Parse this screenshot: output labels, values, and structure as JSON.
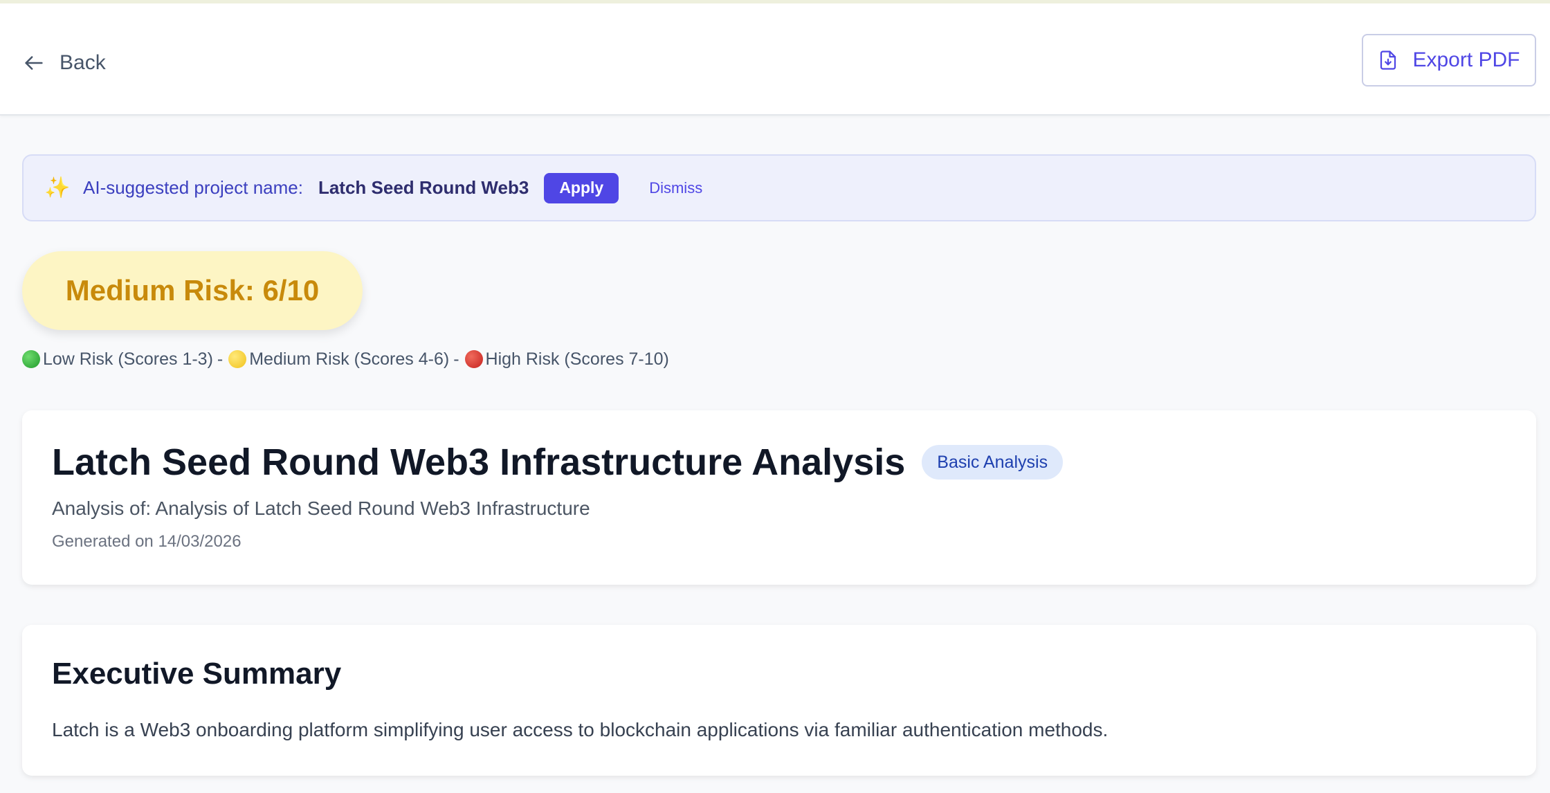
{
  "header": {
    "back_label": "Back",
    "export_label": "Export PDF"
  },
  "suggestion": {
    "icon": "sparkles-icon",
    "label": "AI-suggested project name:",
    "name": "Latch Seed Round Web3",
    "apply_label": "Apply",
    "dismiss_label": "Dismiss"
  },
  "risk": {
    "badge_text": "Medium Risk: 6/10",
    "score": 6,
    "max": 10,
    "color": "#c88a0b",
    "legend": {
      "low": "Low Risk (Scores 1-3)",
      "medium": "Medium Risk (Scores 4-6)",
      "high": "High Risk (Scores 7-10)",
      "separator": "-"
    }
  },
  "report": {
    "title": "Latch Seed Round Web3 Infrastructure Analysis",
    "badge": "Basic Analysis",
    "subtitle": "Analysis of: Analysis of Latch Seed Round Web3 Infrastructure",
    "generated": "Generated on 14/03/2026"
  },
  "summary": {
    "heading": "Executive Summary",
    "body": "Latch is a Web3 onboarding platform simplifying user access to blockchain applications via familiar authentication methods."
  },
  "colors": {
    "accent": "#4f46e5",
    "risk_medium_bg": "#fdf5c4"
  }
}
